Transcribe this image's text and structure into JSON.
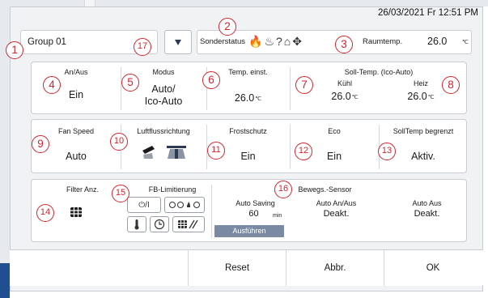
{
  "datetime": "26/03/2021 Fr 12:51 PM",
  "group": {
    "name": "Group 01"
  },
  "status": {
    "label": "Sonderstatus",
    "icons": [
      "flame-icon",
      "defrost-icon",
      "unknown-status-icon",
      "filter-status-icon",
      "move-status-icon"
    ],
    "icon_glyphs": [
      "🔥",
      "♨",
      "?",
      "⌂",
      "✥"
    ],
    "room_temp_label": "Raumtemp.",
    "room_temp_value": "26.0",
    "room_temp_unit": "℃"
  },
  "row1": {
    "onoff": {
      "label": "An/Aus",
      "value": "Ein"
    },
    "mode": {
      "label": "Modus",
      "value_line1": "Auto/",
      "value_line2": "Ico-Auto"
    },
    "set_temp": {
      "label": "Temp. einst.",
      "value": "26.0",
      "unit": "℃"
    },
    "soll_temp": {
      "label": "Soll-Temp. (Ico-Auto)",
      "cool_label": "Kühl",
      "cool_value": "26.0",
      "cool_unit": "℃",
      "heat_label": "Heiz",
      "heat_value": "26.0",
      "heat_unit": "℃"
    }
  },
  "row2": {
    "fan": {
      "label": "Fan Speed",
      "value": "Auto"
    },
    "airflow": {
      "label": "Luftflussrichtung"
    },
    "frost": {
      "label": "Frostschutz",
      "value": "Ein"
    },
    "eco": {
      "label": "Eco",
      "value": "Ein"
    },
    "limit": {
      "label": "SollTemp begrenzt",
      "value": "Aktiv."
    }
  },
  "row3": {
    "filter": {
      "label": "Filter Anz."
    },
    "fb": {
      "label": "FB-Limitierung",
      "btn1": "⏻/I"
    },
    "motion": {
      "label": "Bewegs.-Sensor",
      "saving_label": "Auto Saving",
      "saving_value": "60",
      "saving_unit": "min",
      "execute": "Ausführen",
      "onoff_label": "Auto An/Aus",
      "onoff_value": "Deakt.",
      "off_label": "Auto Aus",
      "off_value": "Deakt."
    }
  },
  "markers": [
    "1",
    "2",
    "3",
    "4",
    "5",
    "6",
    "7",
    "8",
    "9",
    "10",
    "11",
    "12",
    "13",
    "14",
    "15",
    "16",
    "17"
  ],
  "buttons": {
    "reset": "Reset",
    "cancel": "Abbr.",
    "ok": "OK"
  },
  "colors": {
    "marker": "#d8222b",
    "execute_button": "#7a8aa3",
    "accent_blue": "#1f4f8f"
  }
}
